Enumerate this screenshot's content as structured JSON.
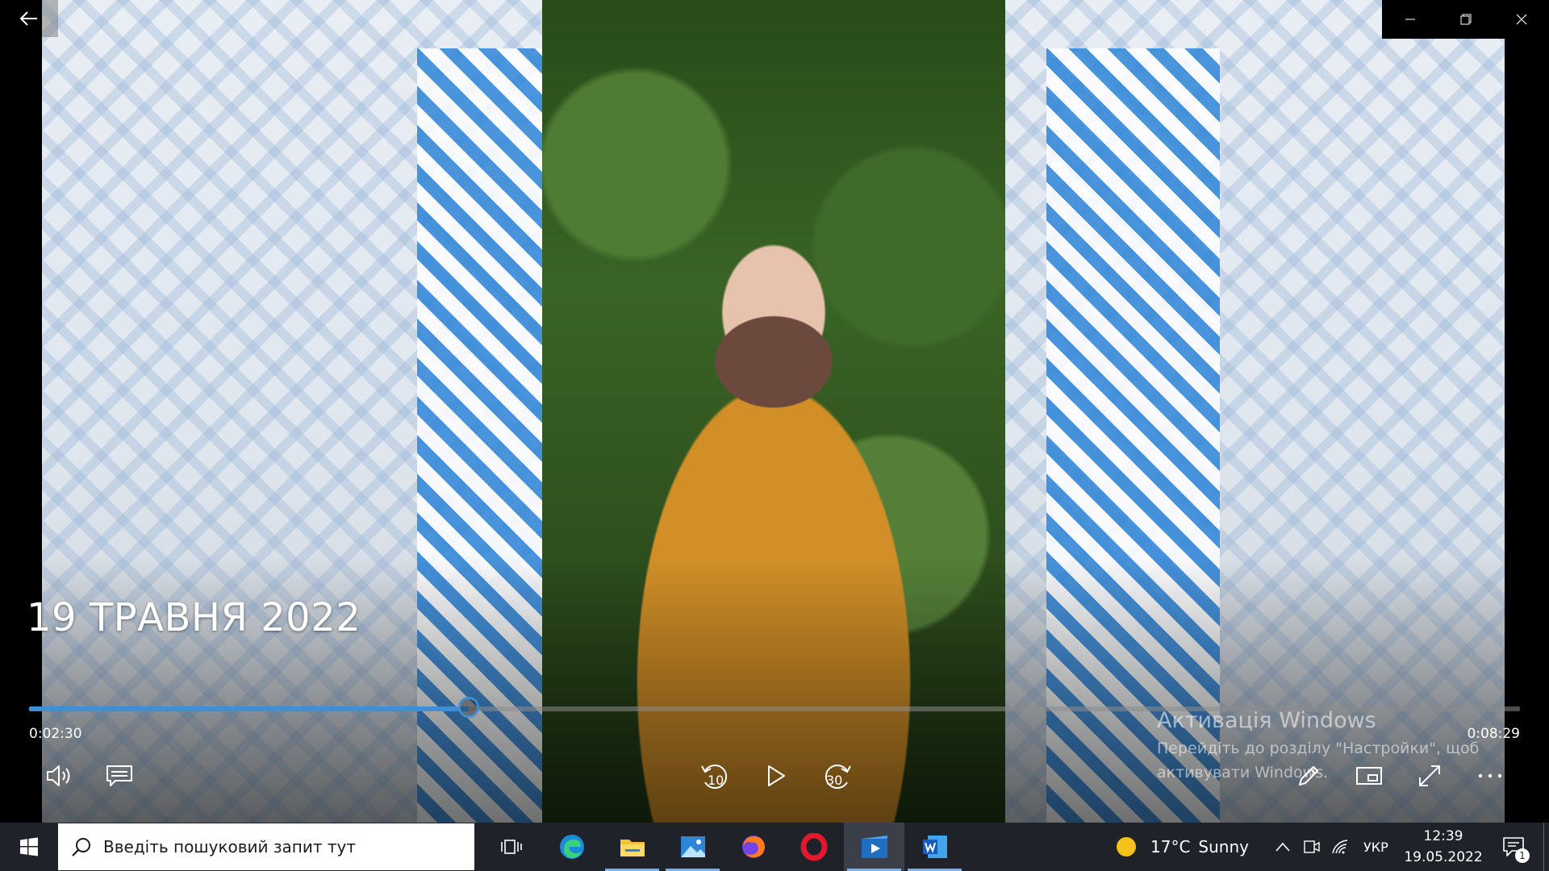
{
  "video": {
    "title": "19 ТРАВНЯ 2022",
    "current_time": "0:02:30",
    "total_time": "0:08:29",
    "progress": 0.295
  },
  "controls": {
    "skip_back_value": "10",
    "skip_forward_value": "30"
  },
  "watermark": {
    "title": "Активація Windows",
    "text": "Перейдіть до розділу \"Настройки\", щоб активувати Windows."
  },
  "taskbar": {
    "search_placeholder": "Введіть пошуковий запит тут",
    "apps": [
      {
        "name": "task-view-icon"
      },
      {
        "name": "edge-icon"
      },
      {
        "name": "file-explorer-icon"
      },
      {
        "name": "photos-icon"
      },
      {
        "name": "firefox-icon"
      },
      {
        "name": "opera-icon"
      },
      {
        "name": "movies-tv-icon"
      },
      {
        "name": "word-icon"
      }
    ],
    "weather": {
      "temp": "17°C",
      "condition": "Sunny"
    },
    "language": "УКР",
    "time": "12:39",
    "date": "19.05.2022",
    "notification_count": "1"
  },
  "colors": {
    "accent": "#3f8fd6",
    "taskbar": "#1f2229"
  }
}
